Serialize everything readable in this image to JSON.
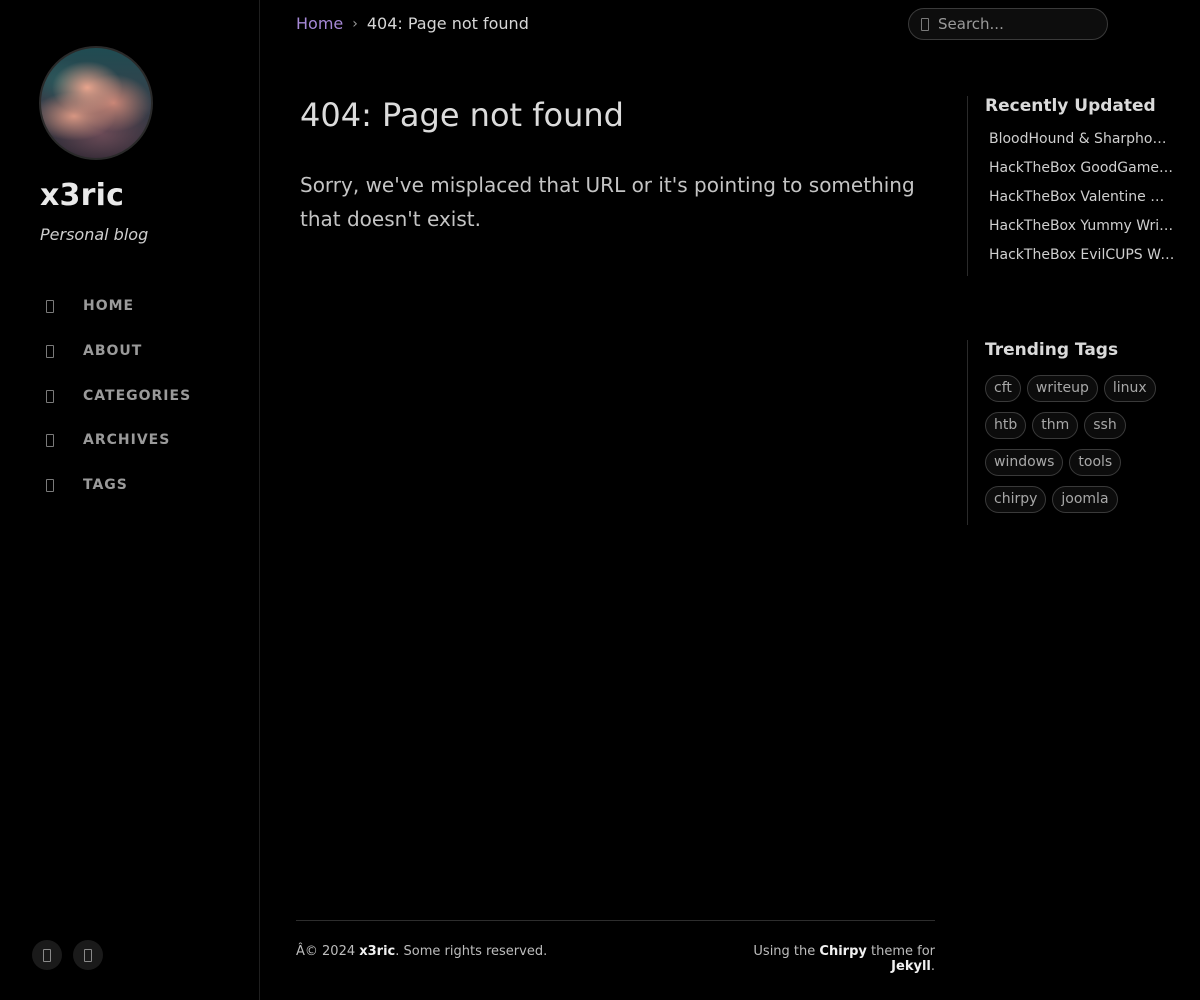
{
  "sidebar": {
    "site_title": "x3ric",
    "site_subtitle": "Personal blog",
    "nav": [
      {
        "label": "HOME",
        "icon": "home-icon"
      },
      {
        "label": "ABOUT",
        "icon": "info-icon"
      },
      {
        "label": "CATEGORIES",
        "icon": "stream-icon"
      },
      {
        "label": "ARCHIVES",
        "icon": "archive-icon"
      },
      {
        "label": "TAGS",
        "icon": "tags-icon"
      }
    ],
    "bottom_buttons": [
      "mode-toggle-icon",
      "github-icon"
    ]
  },
  "topbar": {
    "breadcrumb_home": "Home",
    "breadcrumb_separator": "›",
    "breadcrumb_current": "404: Page not found",
    "search_placeholder": "Search..."
  },
  "main": {
    "title": "404: Page not found",
    "message": "Sorry, we've misplaced that URL or it's pointing to something that doesn't exist."
  },
  "recently_updated": {
    "heading": "Recently Updated",
    "items": [
      "BloodHound & Sharphound",
      "HackTheBox GoodGames ...",
      "HackTheBox Valentine Wri...",
      "HackTheBox Yummy Write...",
      "HackTheBox EvilCUPS Wri..."
    ]
  },
  "trending_tags": {
    "heading": "Trending Tags",
    "rows": [
      [
        "cft",
        "writeup",
        "linux"
      ],
      [
        "htb",
        "thm",
        "ssh"
      ],
      [
        "windows",
        "tools"
      ],
      [
        "chirpy",
        "joomla"
      ]
    ]
  },
  "footer": {
    "copyright_prefix": "Â© 2024 ",
    "owner": "x3ric",
    "rights": ". Some rights reserved.",
    "using_the": "Using the ",
    "theme": "Chirpy",
    "theme_for": " theme for ",
    "generator": "Jekyll",
    "end": "."
  }
}
